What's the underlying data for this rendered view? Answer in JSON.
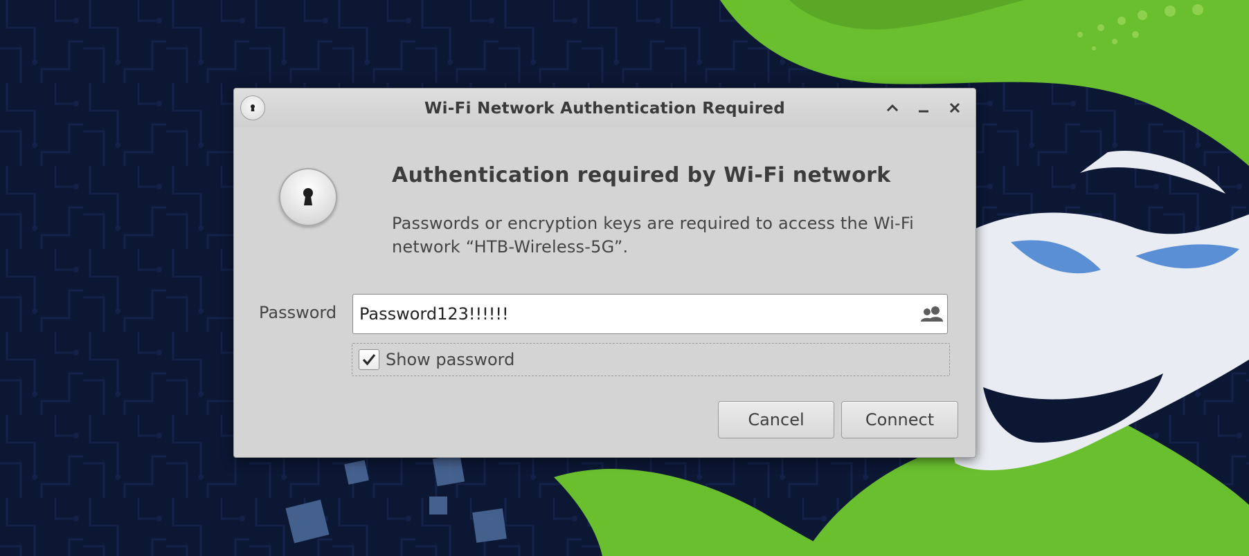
{
  "desktop": {
    "wallpaper": "HTB dark navy wallpaper with green and white artwork",
    "colors": {
      "background": "#0c1734",
      "green": "#6abf2e",
      "white": "#e9ecf2",
      "blue": "#5a8fd6"
    }
  },
  "dialog": {
    "title": "Wi-Fi Network Authentication Required",
    "title_icon": "keyhole-icon",
    "window_buttons": [
      "maximize-icon",
      "minimize-icon",
      "close-icon"
    ],
    "heading": "Authentication required by Wi-Fi network",
    "description": "Passwords or encryption keys are required to access the Wi-Fi network “HTB-Wireless-5G”.",
    "password": {
      "label": "Password",
      "value": "Password123!!!!!!",
      "trailing_icon": "users-icon"
    },
    "show_password": {
      "label": "Show password",
      "checked": true
    },
    "buttons": {
      "cancel": "Cancel",
      "connect": "Connect"
    }
  }
}
